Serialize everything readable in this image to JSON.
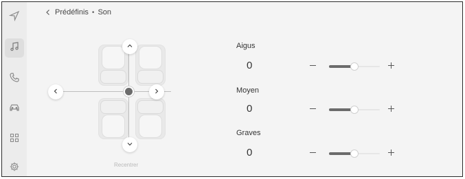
{
  "sidebar": {
    "items": [
      {
        "icon": "navigation-icon"
      },
      {
        "icon": "music-note-icon",
        "active": true
      },
      {
        "icon": "phone-icon"
      },
      {
        "icon": "car-icon"
      },
      {
        "icon": "apps-grid-icon"
      },
      {
        "icon": "gear-icon"
      }
    ]
  },
  "breadcrumb": {
    "back_icon": "chevron-left-icon",
    "parent": "Prédéfinis",
    "separator": "•",
    "current": "Son"
  },
  "fader": {
    "up_icon": "chevron-up-icon",
    "down_icon": "chevron-down-icon",
    "left_icon": "chevron-left-icon",
    "right_icon": "chevron-right-icon",
    "reset_label": "Recentrer"
  },
  "equalizer": {
    "bands": [
      {
        "label": "Aigus",
        "value": "0",
        "level": 0.5
      },
      {
        "label": "Moyen",
        "value": "0",
        "level": 0.5
      },
      {
        "label": "Graves",
        "value": "0",
        "level": 0.5
      }
    ],
    "minus_icon": "minus-icon",
    "plus_icon": "plus-icon"
  },
  "colors": {
    "background": "#f4f4f4",
    "sidebar": "#ececec",
    "slider_fill": "#6b6b6b",
    "border": "#2a2a2a"
  }
}
